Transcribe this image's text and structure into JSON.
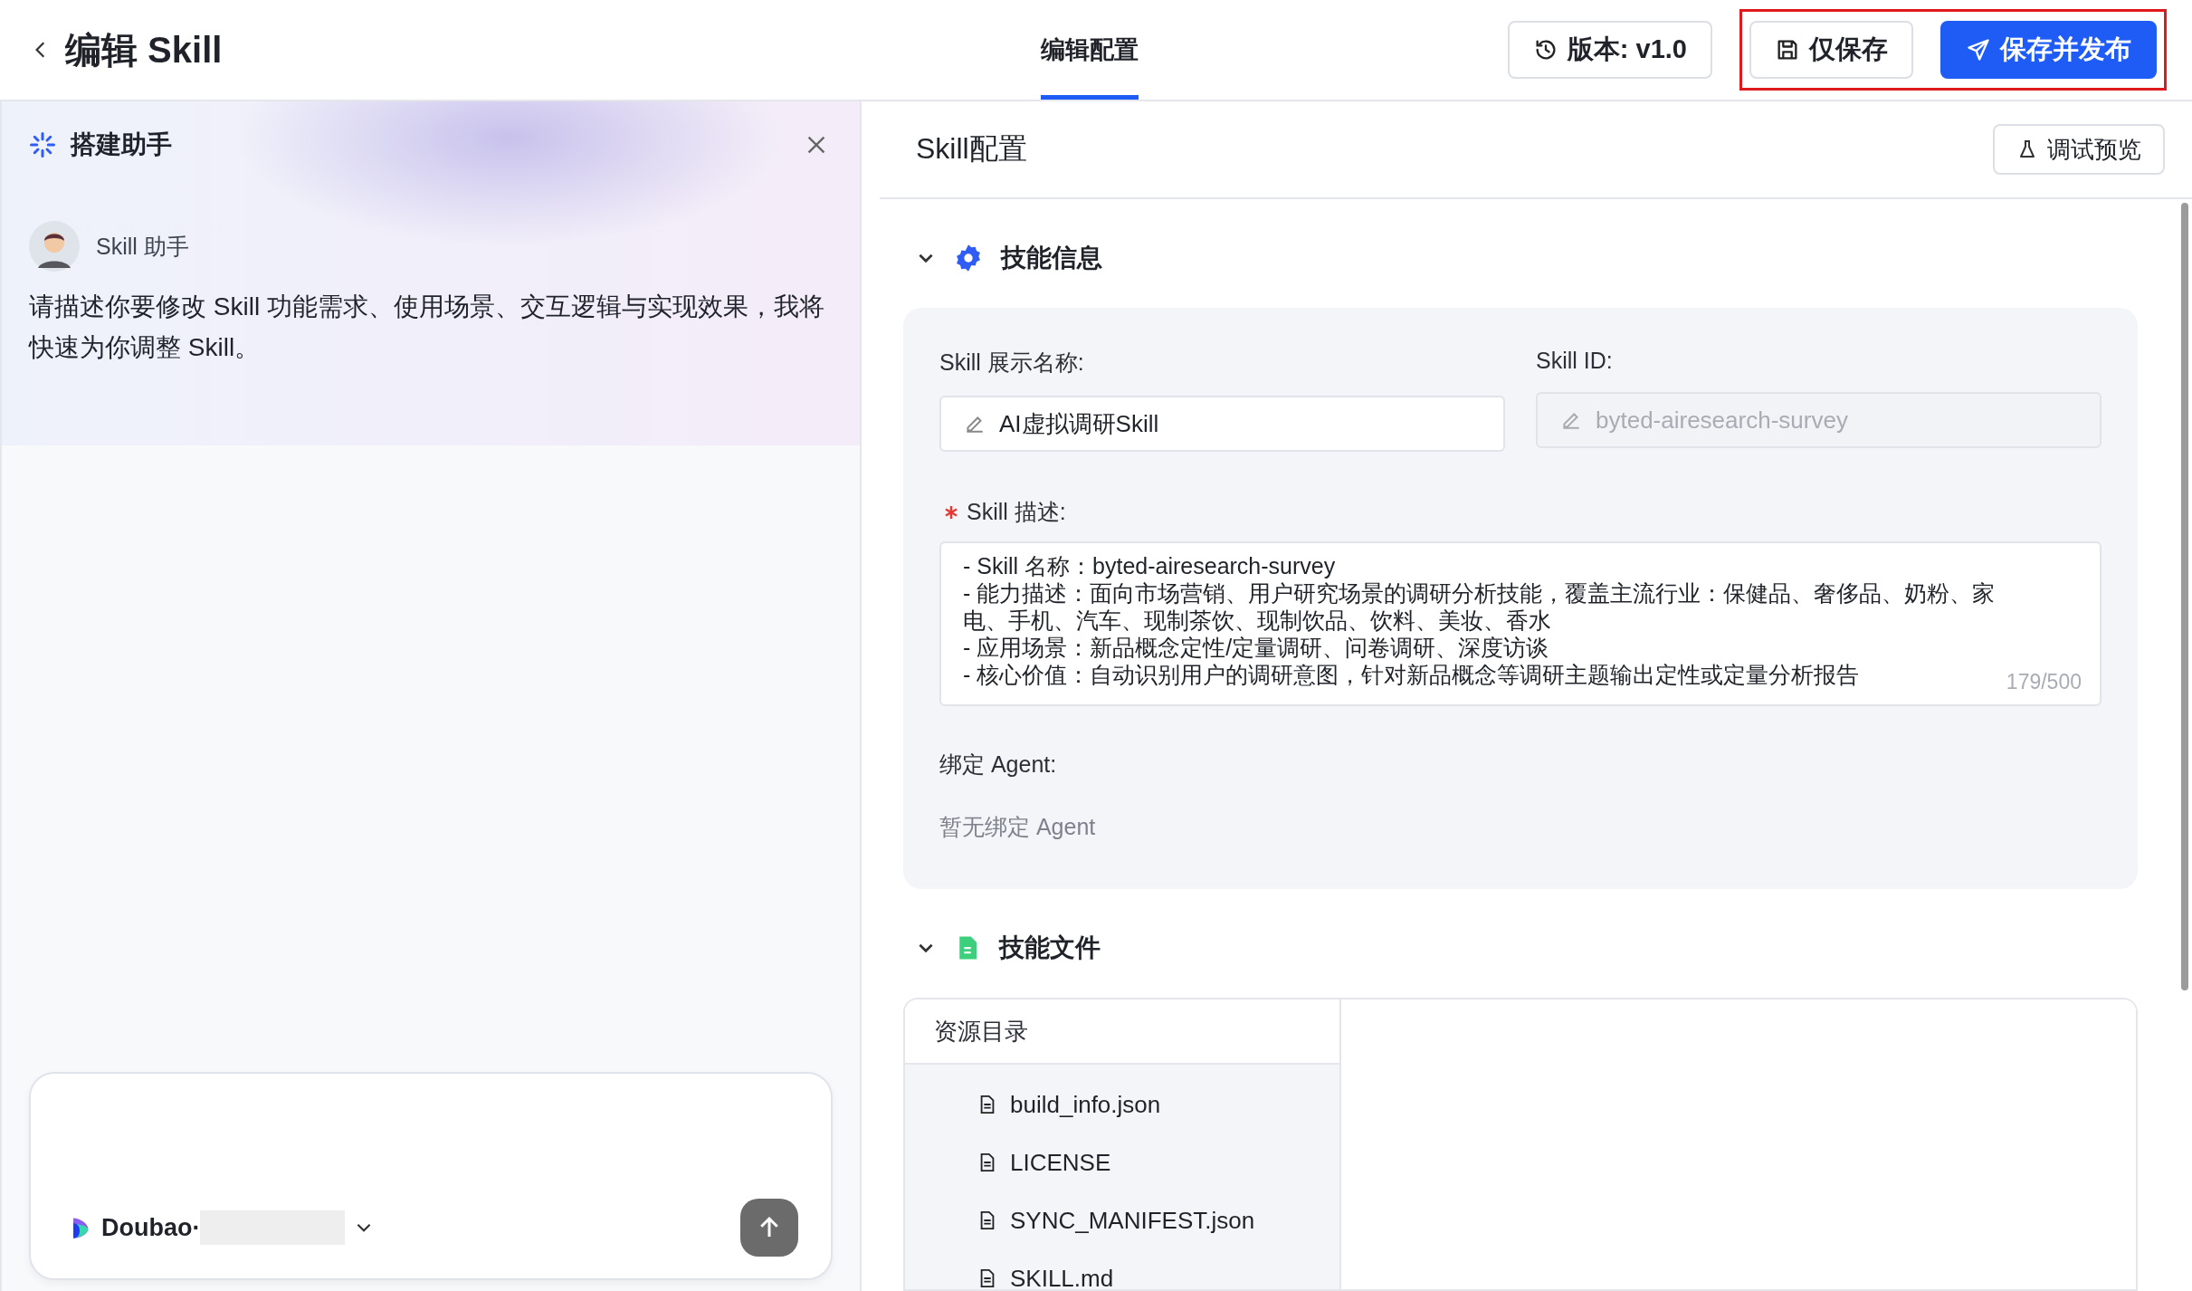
{
  "header": {
    "title": "编辑 Skill",
    "tabs": [
      {
        "label": "编辑配置",
        "selected": true
      }
    ],
    "buttons": [
      {
        "label": "版本: v1.0",
        "kind": "version",
        "highlighted": false
      },
      {
        "label": "仅保存",
        "kind": "save",
        "highlighted": true
      },
      {
        "label": "保存并发布",
        "kind": "publish",
        "highlighted": true
      }
    ]
  },
  "assistant": {
    "title": "搭建助手",
    "sender": "Skill 助手",
    "message": "请描述你要修改 Skill 功能需求、使用场景、交互逻辑与实现效果，我将快速为你调整 Skill。",
    "model": "Doubao·"
  },
  "config": {
    "title": "Skill配置",
    "preview_button": "调试预览",
    "info": {
      "title": "技能信息",
      "expanded": true,
      "name_label": "Skill 展示名称:",
      "name_value": "AI虚拟调研Skill",
      "id_label": "Skill ID:",
      "id_value": "byted-airesearch-survey",
      "id_disabled": true,
      "desc_label": "Skill 描述:",
      "desc_required": true,
      "desc_lines": [
        "- Skill 名称：byted-airesearch-survey",
        "- 能力描述：面向市场营销、用户研究场景的调研分析技能，覆盖主流行业：保健品、奢侈品、奶粉、家电、手机、汽车、现制茶饮、现制饮品、饮料、美妆、香水",
        "- 应用场景：新品概念定性/定量调研、问卷调研、深度访谈",
        "- 核心价值：自动识别用户的调研意图，针对新品概念等调研主题输出定性或定量分析报告"
      ],
      "desc_counter": "179/500",
      "agent_label": "绑定 Agent:",
      "agent_empty": "暂无绑定 Agent"
    },
    "files": {
      "title": "技能文件",
      "expanded": true,
      "tree_title": "资源目录",
      "items": [
        {
          "name": "build_info.json"
        },
        {
          "name": "LICENSE"
        },
        {
          "name": "SYNC_MANIFEST.json"
        },
        {
          "name": "SKILL.md"
        }
      ]
    }
  }
}
